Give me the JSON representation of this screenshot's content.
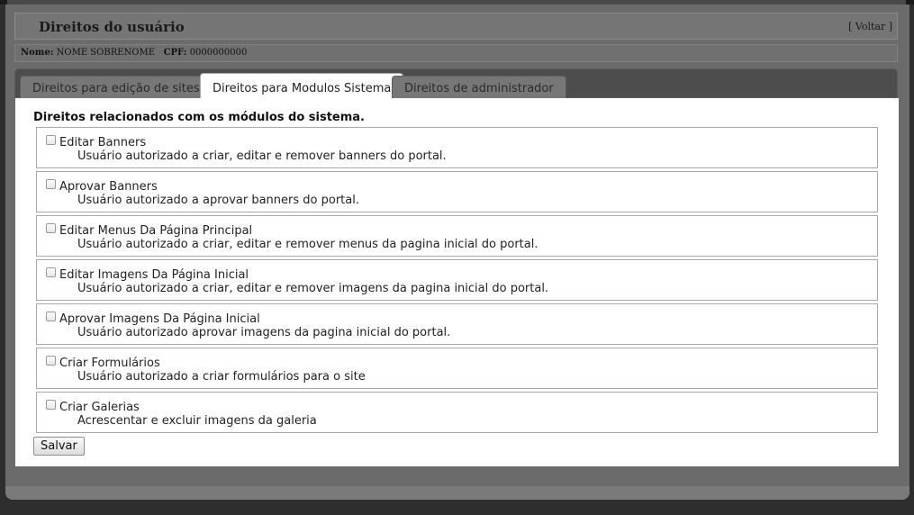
{
  "header": {
    "title": "Direitos do usuário",
    "back_link": "[ Voltar ]"
  },
  "user": {
    "name_label": "Nome:",
    "name_value": "NOME SOBRENOME",
    "cpf_label": "CPF:",
    "cpf_value": "0000000000"
  },
  "tabs": [
    {
      "label": "Direitos para edição de sites",
      "active": false
    },
    {
      "label": "Direitos para Modulos Sistema",
      "active": true
    },
    {
      "label": "Direitos de administrador",
      "active": false
    }
  ],
  "section_title": "Direitos relacionados com os módulos do sistema.",
  "permissions": [
    {
      "label": "Editar Banners",
      "description": "Usuário autorizado a criar, editar e remover banners do portal.",
      "checked": false
    },
    {
      "label": "Aprovar Banners",
      "description": "Usuário autorizado a aprovar banners do portal.",
      "checked": false
    },
    {
      "label": "Editar Menus Da Página Principal",
      "description": "Usuário autorizado a criar, editar e remover menus da pagina inicial do portal.",
      "checked": false
    },
    {
      "label": "Editar Imagens Da Página Inicial",
      "description": "Usuário autorizado a criar, editar e remover imagens da pagina inicial do portal.",
      "checked": false
    },
    {
      "label": "Aprovar Imagens Da Página Inicial",
      "description": "Usuário autorizado aprovar imagens da pagina inicial do portal.",
      "checked": false
    },
    {
      "label": "Criar Formulários",
      "description": "Usuário autorizado a criar formulários para o site",
      "checked": false
    },
    {
      "label": "Criar Galerias",
      "description": "Acrescentar e excluir imagens da galeria",
      "checked": false
    }
  ],
  "save_label": "Salvar"
}
